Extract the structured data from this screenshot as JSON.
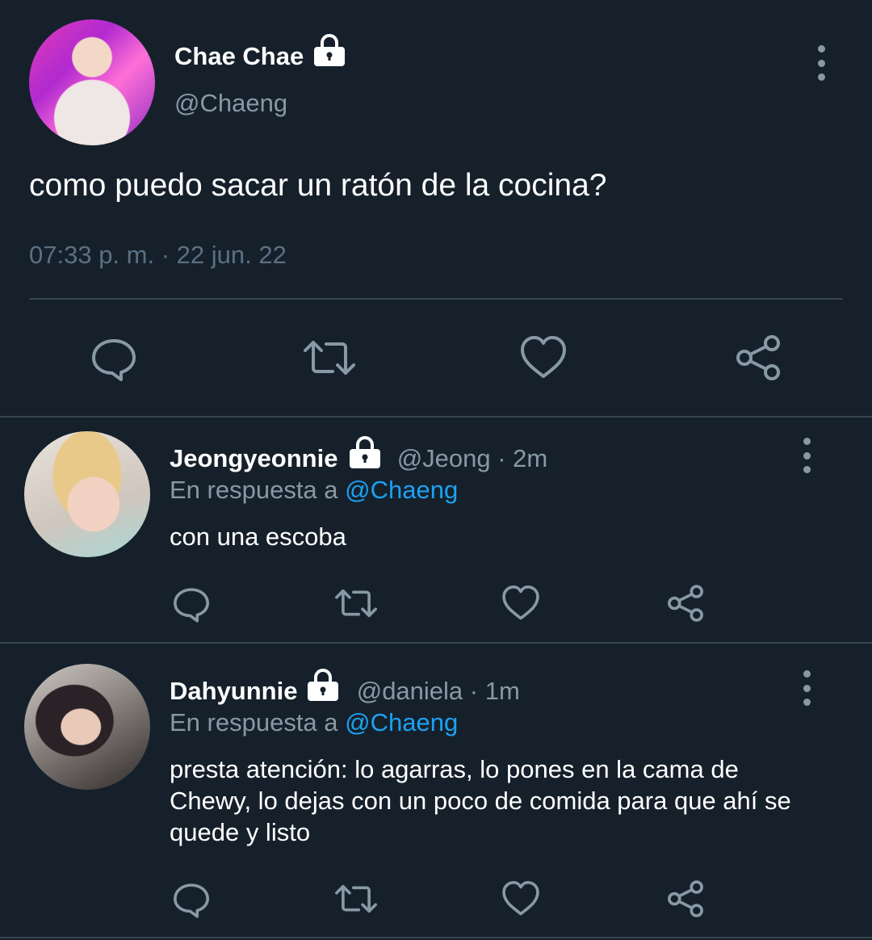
{
  "main_tweet": {
    "display_name": "Chae Chae",
    "handle": "@Chaeng",
    "text": "como puedo sacar un ratón de la cocina?",
    "timestamp": "07:33 p. m. · 22 jun. 22",
    "avatar_icon": "user-avatar"
  },
  "replies": [
    {
      "display_name": "Jeongyeonnie",
      "handle": "@Jeong",
      "time": " · 2m",
      "reply_prefix": "En respuesta a ",
      "mention": "@Chaeng",
      "text": "con una escoba"
    },
    {
      "display_name": "Dahyunnie",
      "handle": "@daniela",
      "time": " · 1m",
      "reply_prefix": "En respuesta a ",
      "mention": "@Chaeng",
      "text": "presta atención: lo agarras, lo pones en la cama de Chewy, lo dejas con un poco de comida para que ahí se quede y listo"
    }
  ],
  "colors": {
    "background": "#15202b",
    "secondary_text": "#8899a6",
    "link": "#1da1f2",
    "divider": "#38444d"
  },
  "icons": {
    "reply": "reply-icon",
    "retweet": "retweet-icon",
    "like": "heart-icon",
    "share": "share-icon",
    "more": "more-vertical-icon",
    "protected": "lock-icon"
  }
}
